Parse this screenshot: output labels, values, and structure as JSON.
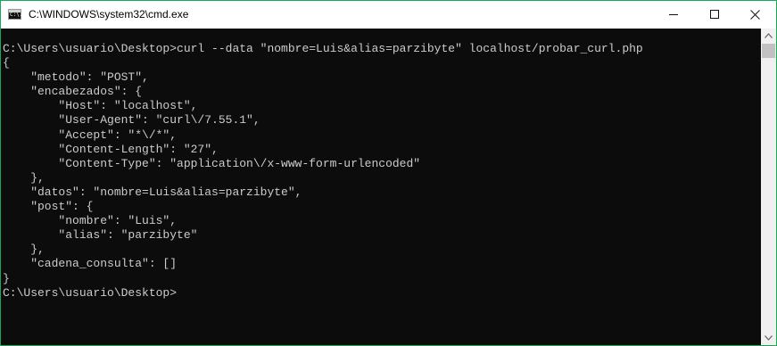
{
  "window": {
    "title": "C:\\WINDOWS\\system32\\cmd.exe",
    "icon": "cmd-icon",
    "icon_glyph": "C:\\."
  },
  "caption_buttons": {
    "minimize_icon": "minimize-icon",
    "maximize_icon": "maximize-icon",
    "close_icon": "close-icon"
  },
  "console": {
    "lines": [
      "C:\\Users\\usuario\\Desktop>curl --data \"nombre=Luis&alias=parzibyte\" localhost/probar_curl.php",
      "{",
      "    \"metodo\": \"POST\",",
      "    \"encabezados\": {",
      "        \"Host\": \"localhost\",",
      "        \"User-Agent\": \"curl\\/7.55.1\",",
      "        \"Accept\": \"*\\/*\",",
      "        \"Content-Length\": \"27\",",
      "        \"Content-Type\": \"application\\/x-www-form-urlencoded\"",
      "    },",
      "    \"datos\": \"nombre=Luis&alias=parzibyte\",",
      "    \"post\": {",
      "        \"nombre\": \"Luis\",",
      "        \"alias\": \"parzibyte\"",
      "    },",
      "    \"cadena_consulta\": []",
      "}",
      "C:\\Users\\usuario\\Desktop>"
    ]
  },
  "scrollbar": {
    "up_icon": "scroll-up-arrow-icon",
    "down_icon": "scroll-down-arrow-icon"
  },
  "colors": {
    "console_background": "#0c0c0c",
    "console_text": "#cccccc",
    "window_border": "#17a85a"
  }
}
